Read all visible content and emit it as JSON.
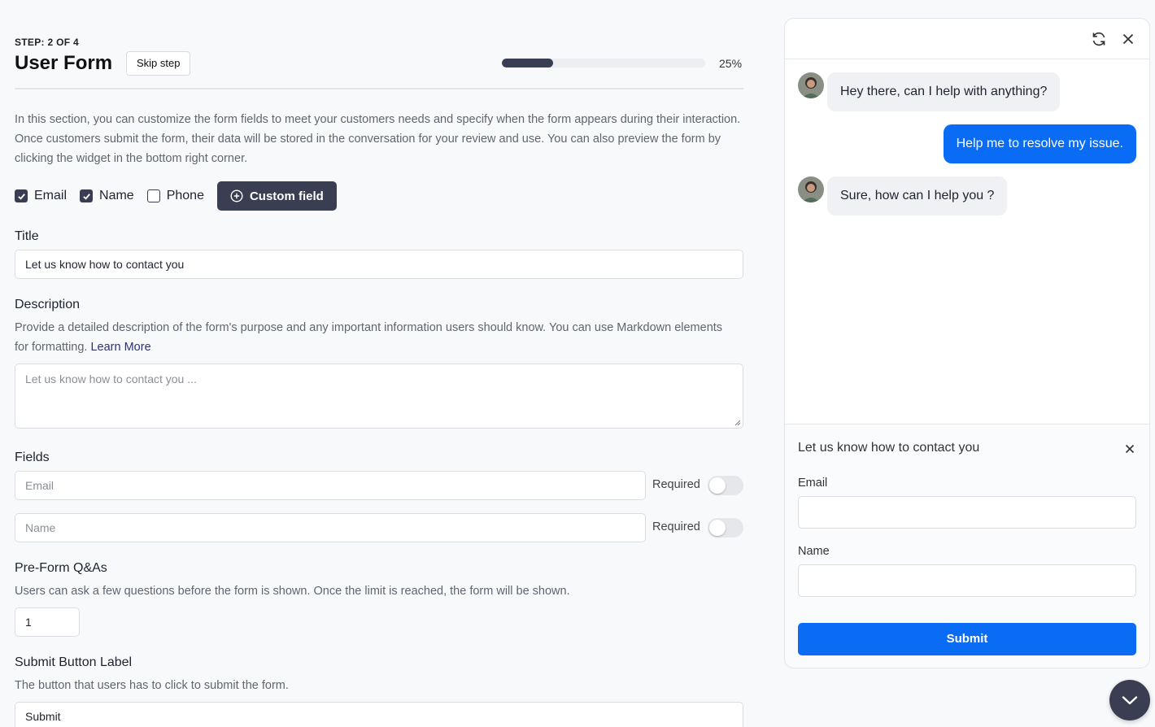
{
  "header": {
    "step": "STEP: 2 OF 4",
    "title": "User Form",
    "skip_label": "Skip step",
    "progress_percent": 25,
    "progress_text": "25%"
  },
  "intro": "In this section, you can customize the form fields to meet your customers needs and specify when the form appears during their interaction. Once customers submit the form, their data will be stored in the conversation for your review and use. You can also preview the form by clicking the widget in the bottom right corner.",
  "checkboxes": [
    {
      "label": "Email",
      "checked": true
    },
    {
      "label": "Name",
      "checked": true
    },
    {
      "label": "Phone",
      "checked": false
    }
  ],
  "custom_field_label": "Custom field",
  "title_section": {
    "label": "Title",
    "value": "Let us know how to contact you"
  },
  "description_section": {
    "label": "Description",
    "help": "Provide a detailed description of the form's purpose and any important information users should know. You can use Markdown elements for formatting.",
    "link": "Learn More",
    "placeholder": "Let us know how to contact you ..."
  },
  "fields_section": {
    "label": "Fields",
    "items": [
      {
        "placeholder": "Email",
        "required_label": "Required",
        "required": false
      },
      {
        "placeholder": "Name",
        "required_label": "Required",
        "required": false
      }
    ]
  },
  "preform_section": {
    "label": "Pre-Form Q&As",
    "help": "Users can ask a few questions before the form is shown. Once the limit is reached, the form will be shown.",
    "value": "1"
  },
  "submit_section": {
    "label": "Submit Button Label",
    "help": "The button that users has to click to submit the form.",
    "value": "Submit"
  },
  "chat": {
    "messages": [
      {
        "from": "bot",
        "text": "Hey there, can I help with anything?"
      },
      {
        "from": "user",
        "text": "Help me to resolve my issue."
      },
      {
        "from": "bot",
        "text": "Sure, how can I help you ?"
      }
    ],
    "form": {
      "title": "Let us know how to contact you",
      "email_label": "Email",
      "name_label": "Name",
      "submit_label": "Submit"
    }
  },
  "colors": {
    "primary_dark": "#3a3e52",
    "accent_blue": "#0a6cf5"
  },
  "icons": [
    "refresh-icon",
    "close-icon",
    "plus-circle-icon",
    "chevron-down-icon",
    "check-icon",
    "resize-grip-icon"
  ]
}
